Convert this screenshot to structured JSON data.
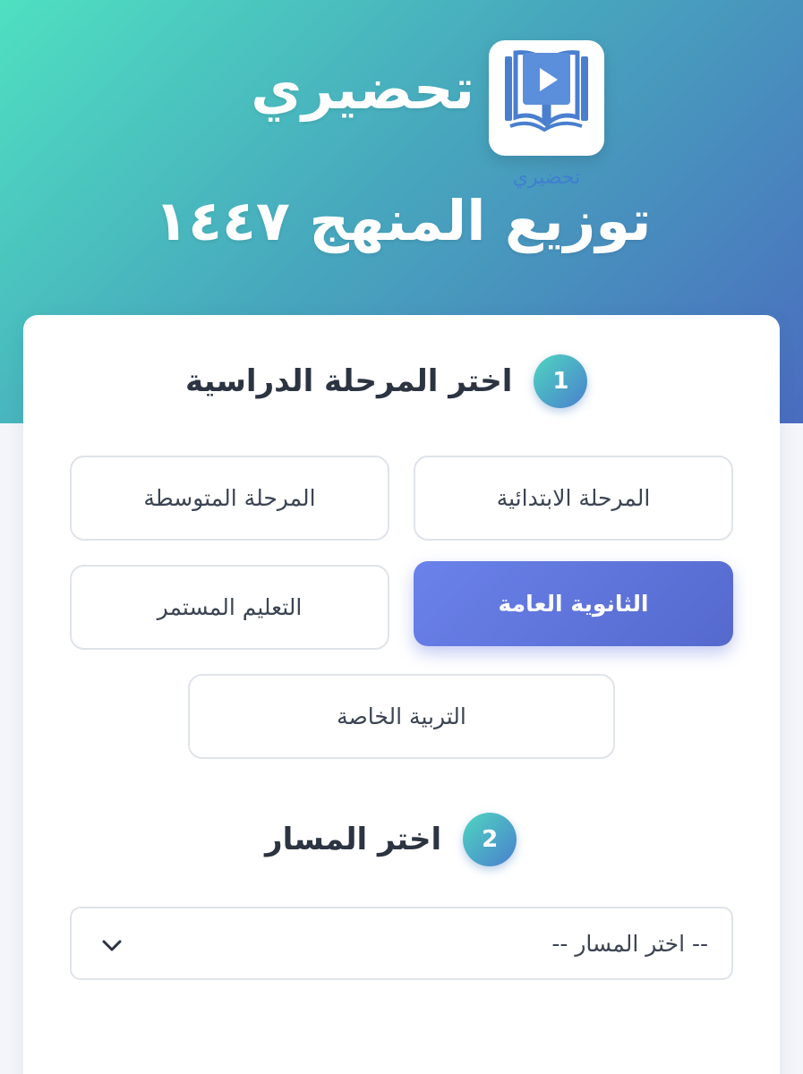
{
  "header": {
    "brand_title": "تحضيري",
    "logo_text": "تحضيري",
    "subtitle": "توزيع المنهج ١٤٤٧",
    "colors": {
      "gradient_start": "#4fe0c1",
      "gradient_end": "#4a6cbf"
    }
  },
  "step1": {
    "number": "1",
    "title": "اختر المرحلة الدراسية",
    "options": [
      {
        "label": "المرحلة الابتدائية",
        "selected": false
      },
      {
        "label": "المرحلة المتوسطة",
        "selected": false
      },
      {
        "label": "الثانوية العامة",
        "selected": true
      },
      {
        "label": "التعليم المستمر",
        "selected": false
      },
      {
        "label": "التربية الخاصة",
        "selected": false
      }
    ]
  },
  "step2": {
    "number": "2",
    "title": "اختر المسار",
    "select_value": "-- اختر المسار --",
    "select_icon": "chevron-down-icon"
  },
  "colors": {
    "accent": "#5d73dc",
    "step_badge": "#4fa9c8"
  }
}
